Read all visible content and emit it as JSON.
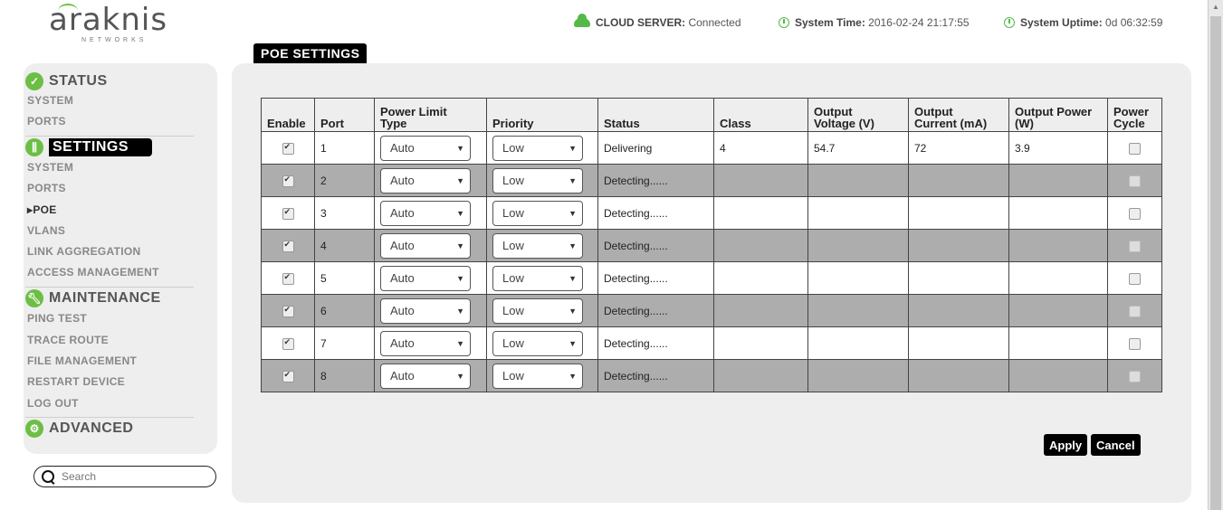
{
  "logo": {
    "word": "araknis",
    "sub": "NETWORKS"
  },
  "header": {
    "cloud_label": "CLOUD SERVER:",
    "cloud_value": "Connected",
    "time_label": "System Time:",
    "time_value": "2016-02-24 21:17:55",
    "uptime_label": "System Uptime:",
    "uptime_value": "0d 06:32:59"
  },
  "sidebar": {
    "status": {
      "label": "STATUS",
      "items": [
        "SYSTEM",
        "PORTS"
      ]
    },
    "settings": {
      "label": "SETTINGS",
      "items": [
        "SYSTEM",
        "PORTS",
        "▸POE",
        "VLANS",
        "LINK AGGREGATION",
        "ACCESS MANAGEMENT"
      ]
    },
    "maintenance": {
      "label": "MAINTENANCE",
      "items": [
        "PING TEST",
        "TRACE ROUTE",
        "FILE MANAGEMENT",
        "RESTART DEVICE",
        "LOG OUT"
      ]
    },
    "advanced": {
      "label": "ADVANCED"
    }
  },
  "search": {
    "placeholder": "Search"
  },
  "page_title": "POE SETTINGS",
  "table": {
    "headers": {
      "enable": "Enable",
      "port": "Port",
      "plt1": "Power Limit",
      "plt2": "Type",
      "priority": "Priority",
      "status": "Status",
      "class": "Class",
      "ov1": "Output",
      "ov2": "Voltage (V)",
      "oc1": "Output",
      "oc2": "Current (mA)",
      "op1": "Output Power",
      "op2": "(W)",
      "pc1": "Power",
      "pc2": "Cycle"
    },
    "rows": [
      {
        "port": "1",
        "limit": "Auto",
        "priority": "Low",
        "status": "Delivering",
        "class": "4",
        "voltage": "54.7",
        "current": "72",
        "power": "3.9"
      },
      {
        "port": "2",
        "limit": "Auto",
        "priority": "Low",
        "status": "Detecting......",
        "class": "",
        "voltage": "",
        "current": "",
        "power": ""
      },
      {
        "port": "3",
        "limit": "Auto",
        "priority": "Low",
        "status": "Detecting......",
        "class": "",
        "voltage": "",
        "current": "",
        "power": ""
      },
      {
        "port": "4",
        "limit": "Auto",
        "priority": "Low",
        "status": "Detecting......",
        "class": "",
        "voltage": "",
        "current": "",
        "power": ""
      },
      {
        "port": "5",
        "limit": "Auto",
        "priority": "Low",
        "status": "Detecting......",
        "class": "",
        "voltage": "",
        "current": "",
        "power": ""
      },
      {
        "port": "6",
        "limit": "Auto",
        "priority": "Low",
        "status": "Detecting......",
        "class": "",
        "voltage": "",
        "current": "",
        "power": ""
      },
      {
        "port": "7",
        "limit": "Auto",
        "priority": "Low",
        "status": "Detecting......",
        "class": "",
        "voltage": "",
        "current": "",
        "power": ""
      },
      {
        "port": "8",
        "limit": "Auto",
        "priority": "Low",
        "status": "Detecting......",
        "class": "",
        "voltage": "",
        "current": "",
        "power": ""
      }
    ]
  },
  "buttons": {
    "apply": "Apply",
    "cancel": "Cancel"
  },
  "colors": {
    "brand_green": "#6cbe45",
    "row_alt": "#adadad",
    "panel": "#eeeeee"
  }
}
